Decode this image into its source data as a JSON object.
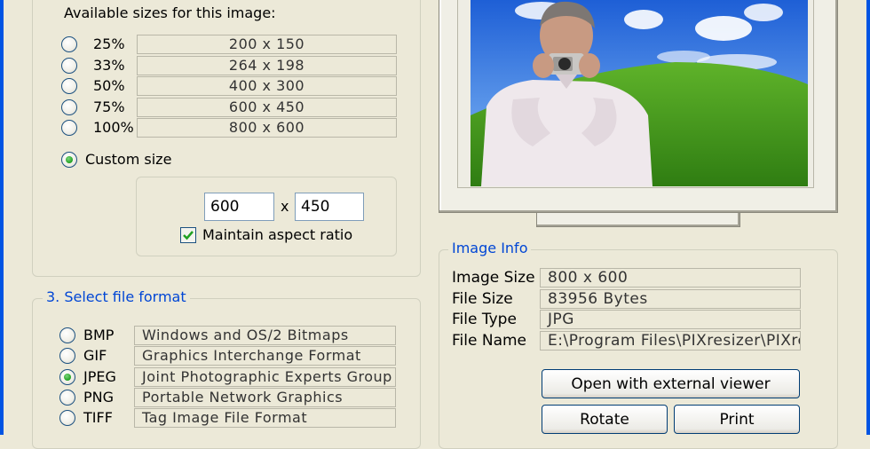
{
  "sizes": {
    "heading": "Available sizes for this image:",
    "options": [
      {
        "percent": "25%",
        "dims": "200 x 150",
        "selected": false
      },
      {
        "percent": "33%",
        "dims": "264 x 198",
        "selected": false
      },
      {
        "percent": "50%",
        "dims": "400 x 300",
        "selected": false
      },
      {
        "percent": "75%",
        "dims": "600 x 450",
        "selected": false
      },
      {
        "percent": "100%",
        "dims": "800 x 600",
        "selected": false
      }
    ],
    "custom": {
      "label": "Custom size",
      "selected": true,
      "width": "600",
      "times": "x",
      "height": "450",
      "aspect_label": "Maintain aspect ratio",
      "aspect_checked": true
    }
  },
  "format": {
    "legend": "3. Select file format",
    "options": [
      {
        "name": "BMP",
        "desc": "Windows and OS/2 Bitmaps",
        "selected": false
      },
      {
        "name": "GIF",
        "desc": "Graphics Interchange Format",
        "selected": false
      },
      {
        "name": "JPEG",
        "desc": "Joint Photographic Experts Group",
        "selected": true
      },
      {
        "name": "PNG",
        "desc": "Portable Network Graphics",
        "selected": false
      },
      {
        "name": "TIFF",
        "desc": "Tag Image File Format",
        "selected": false
      }
    ]
  },
  "info": {
    "legend": "Image Info",
    "rows": [
      {
        "label": "Image Size",
        "value": "800 x 600"
      },
      {
        "label": "File Size",
        "value": "83956 Bytes"
      },
      {
        "label": "File Type",
        "value": "JPG"
      },
      {
        "label": "File Name",
        "value": "E:\\Program Files\\PIXresizer\\PIXresiz"
      }
    ],
    "buttons": {
      "external": "Open with external viewer",
      "rotate": "Rotate",
      "print": "Print"
    }
  },
  "colors": {
    "accent": "#0046d5",
    "window_frame": "#0054e3",
    "face": "#ece9d8",
    "radio_on": "#21a121"
  }
}
